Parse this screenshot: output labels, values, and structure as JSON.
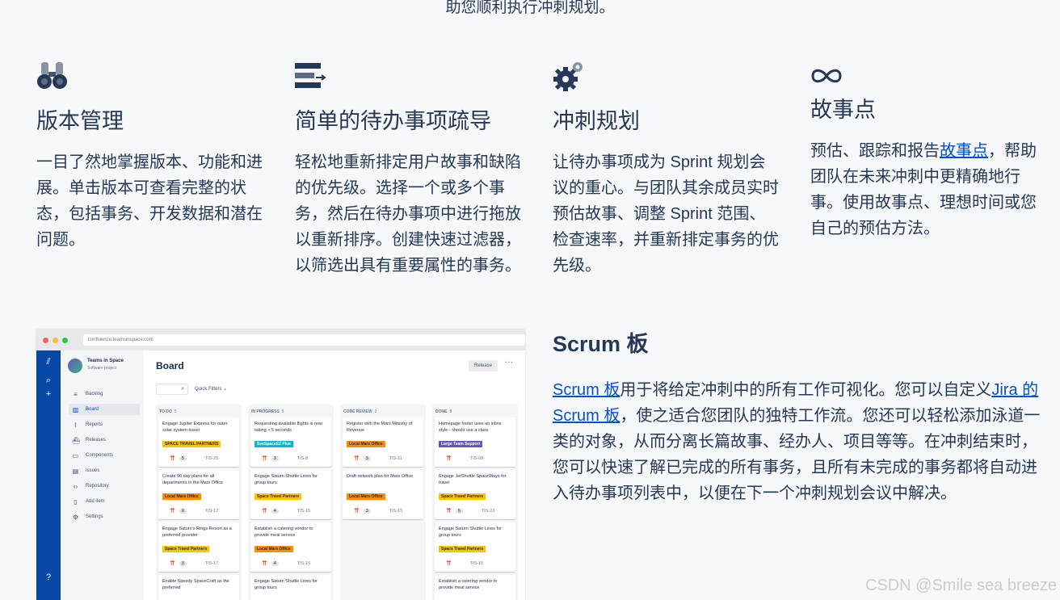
{
  "intro": "助您顺利执行冲刺规划。",
  "features": [
    {
      "icon": "binoculars-icon",
      "title": "版本管理",
      "text": "一目了然地掌握版本、功能和进展。单击版本可查看完整的状态，包括事务、开发数据和潜在问题。"
    },
    {
      "icon": "backlog-list-icon",
      "title": "简单的待办事项疏导",
      "text": "轻松地重新排定用户故事和缺陷的优先级。选择一个或多个事务，然后在待办事项中进行拖放以重新排序。创建快速过滤器，以筛选出具有重要属性的事务。"
    },
    {
      "icon": "gears-icon",
      "title": "冲刺规划",
      "text": "让待办事项成为 Sprint 规划会议的重心。与团队其余成员实时预估故事、调整 Sprint 范围、检查速率，并重新排定事务的优先级。"
    },
    {
      "icon": "infinity-icon",
      "title": "故事点",
      "text_before": "预估、跟踪和报告",
      "link": "故事点",
      "text_after": "，帮助团队在未来冲刺中更精确地行事。使用故事点、理想时间或您自己的预估方法。"
    }
  ],
  "scrum": {
    "title": "Scrum 板",
    "link1": "Scrum 板",
    "text1": "用于将给定冲刺中的所有工作可视化。您可以自定义",
    "link2": "Jira 的 Scrum 板",
    "text2": "，使之适合您团队的独特工作流。您还可以轻松添加泳道一类的对象，从而分离长篇故事、经办人、项目等等。在冲刺结束时，您可以快速了解已完成的所有事务，且所有未完成的事务都将自动进入待办事项列表中，以便在下一个冲刺规划会议中解决。"
  },
  "mockup": {
    "url": "confluence.teamsinspace.com",
    "project_name": "Teams in Space",
    "project_type": "Software project",
    "nav": [
      {
        "icon": "backlog-icon",
        "label": "Backlog"
      },
      {
        "icon": "board-icon",
        "label": "Board",
        "active": true
      },
      {
        "icon": "reports-icon",
        "label": "Reports"
      },
      {
        "icon": "releases-icon",
        "label": "Releases"
      },
      {
        "icon": "components-icon",
        "label": "Components"
      },
      {
        "icon": "issues-icon",
        "label": "Issues"
      },
      {
        "icon": "repository-icon",
        "label": "Repository"
      },
      {
        "icon": "add-item-icon",
        "label": "Add item"
      },
      {
        "icon": "settings-icon",
        "label": "Settings"
      }
    ],
    "board_title": "Board",
    "release_label": "Release",
    "quick_filters": "Quick Filters",
    "columns": [
      {
        "title": "TO DO",
        "count": "5",
        "cards": [
          {
            "title": "Engage Jupiter Express for outer solar system travel",
            "label": "SPACE TRAVEL PARTNERS",
            "color": "#ffc400",
            "points": "5",
            "key": "TIS-25"
          },
          {
            "title": "Create 90 day plans for all departments in the Mars Office",
            "label": "Local Mars Office",
            "color": "#ff8b00",
            "points": "9",
            "key": "TIS-12"
          },
          {
            "title": "Engage Saturn's Rings Resort as a preferred provider",
            "label": "Space Travel Partners",
            "color": "#ffc400",
            "points": "3",
            "key": "TIS-17"
          },
          {
            "title": "Enable Speedy SpaceCraft as the preferred",
            "label": "",
            "color": "#ffc400",
            "points": "",
            "key": ""
          }
        ]
      },
      {
        "title": "IN PROGRESS",
        "count": "5",
        "cards": [
          {
            "title": "Requesting available flights is now taking > 5 seconds",
            "label": "SeeSpaceEZ Plus",
            "color": "#00b8d9",
            "points": "3",
            "key": "TIS-8"
          },
          {
            "title": "Engage Saturn Shuttle Lines for group tours",
            "label": "Space Travel Partners",
            "color": "#ffc400",
            "points": "4",
            "key": "TIS-15"
          },
          {
            "title": "Establish a catering vendor to provide meal service",
            "label": "Local Mars Office",
            "color": "#ff8b00",
            "points": "4",
            "key": "TIS-15"
          },
          {
            "title": "Engage Saturn Shuttle Lines for group tours",
            "label": "",
            "color": "#ffc400",
            "points": "",
            "key": ""
          }
        ]
      },
      {
        "title": "CODE REVIEW",
        "count": "2",
        "cards": [
          {
            "title": "Register with the Mars Ministry of Revenue",
            "label": "Local Mars Office",
            "color": "#ff8b00",
            "points": "3",
            "key": "TIS-11"
          },
          {
            "title": "Draft network plan for Mars Office",
            "label": "Local Mars Office",
            "color": "#ff8b00",
            "points": "3",
            "key": "TIS-15"
          }
        ]
      },
      {
        "title": "DONE",
        "count": "8",
        "cards": [
          {
            "title": "Homepage footer uses an inline style - should use a class",
            "label": "Large Team Support",
            "color": "#6554c0",
            "points": "",
            "key": "TIS-68"
          },
          {
            "title": "Engage JetShuttle SpaceWays for travel",
            "label": "Space Travel Partners",
            "color": "#ffc400",
            "points": "5",
            "key": "TIS-23"
          },
          {
            "title": "Engage Saturn Shuttle Lines for group tours",
            "label": "Space Travel Partners",
            "color": "#ffc400",
            "points": "",
            "key": "TIS-15"
          },
          {
            "title": "Establish a catering vendor to provide meal service",
            "label": "",
            "color": "#ff8b00",
            "points": "",
            "key": ""
          }
        ]
      }
    ]
  },
  "watermark": "CSDN @Smile sea breeze"
}
